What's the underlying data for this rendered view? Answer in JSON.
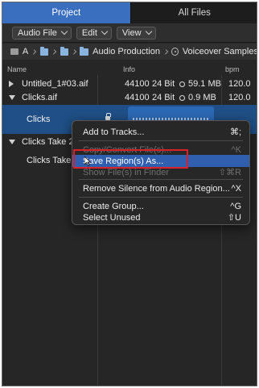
{
  "tabs": {
    "project": "Project",
    "all_files": "All Files"
  },
  "toolbar": {
    "audio_file": "Audio File",
    "edit": "Edit",
    "view": "View"
  },
  "pathbar": {
    "drive": "A",
    "folder": "Audio Production",
    "current": "Voiceover Samples"
  },
  "columns": {
    "name": "Name",
    "info": "Info",
    "bpm": "bpm"
  },
  "files": [
    {
      "name": "Untitled_1#03.aif",
      "rate": "44100",
      "bits": "24 Bit",
      "size": "59.1 MB",
      "bpm": "120.0",
      "expanded": false
    },
    {
      "name": "Clicks.aif",
      "rate": "44100",
      "bits": "24 Bit",
      "size": "0.9 MB",
      "bpm": "120.0",
      "expanded": true
    }
  ],
  "regions": {
    "clicks": "Clicks",
    "take_parent": "Clicks Take 2...",
    "take_child": "Clicks Take"
  },
  "context_menu": {
    "add_to_tracks": "Add to Tracks...",
    "add_to_tracks_sc": "⌘;",
    "copy_convert": "Copy/Convert File(s)...",
    "copy_convert_sc": "^K",
    "save_region": "Save Region(s) As...",
    "show_in_finder": "Show File(s) in Finder",
    "show_in_finder_sc": "⇧⌘R",
    "remove_silence": "Remove Silence from Audio Region...",
    "remove_silence_sc": "^X",
    "create_group": "Create Group...",
    "create_group_sc": "^G",
    "select_unused": "Select Unused",
    "select_unused_sc": "⇧U"
  },
  "colors": {
    "accent": "#3a6ebf",
    "highlight": "#2f5fae",
    "annotation": "#d9212b"
  }
}
